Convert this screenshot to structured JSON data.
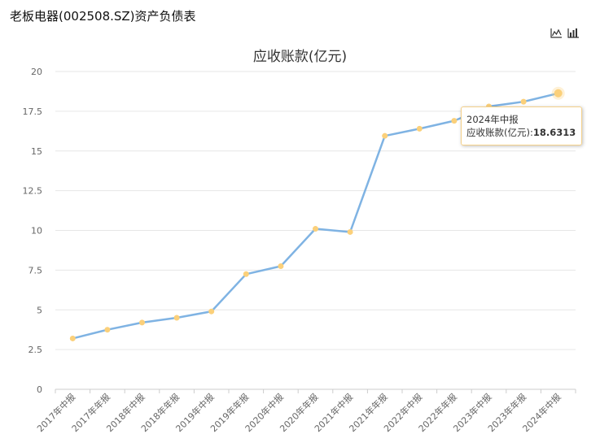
{
  "page": {
    "title": "老板电器(002508.SZ)资产负债表"
  },
  "toolbar": {
    "icons": [
      "line-chart-icon",
      "bar-chart-icon"
    ]
  },
  "colors": {
    "line": "#7fb3e3",
    "marker": "#fbd07a",
    "grid": "#e6e6e6",
    "axis": "#cccccc",
    "tooltip_border": "#f4d08a"
  },
  "chart_data": {
    "type": "line",
    "title": "应收账款(亿元)",
    "xlabel": "",
    "ylabel": "",
    "ylim": [
      0,
      20
    ],
    "yticks": [
      "0",
      "2.5",
      "5",
      "7.5",
      "10",
      "12.5",
      "15",
      "17.5",
      "20"
    ],
    "grid": true,
    "categories": [
      "2017年中报",
      "2017年年报",
      "2018年中报",
      "2018年年报",
      "2019年中报",
      "2019年年报",
      "2020年中报",
      "2020年年报",
      "2021年中报",
      "2021年年报",
      "2022年中报",
      "2022年年报",
      "2023年中报",
      "2023年年报",
      "2024年中报"
    ],
    "series": [
      {
        "name": "应收账款(亿元)",
        "values": [
          3.2,
          3.75,
          4.2,
          4.5,
          4.9,
          7.25,
          7.75,
          10.1,
          9.9,
          15.95,
          16.4,
          16.9,
          17.8,
          18.1,
          18.6313
        ]
      }
    ],
    "tooltip": {
      "category": "2024年中报",
      "label": "应收账款(亿元):",
      "value": "18.6313"
    }
  }
}
